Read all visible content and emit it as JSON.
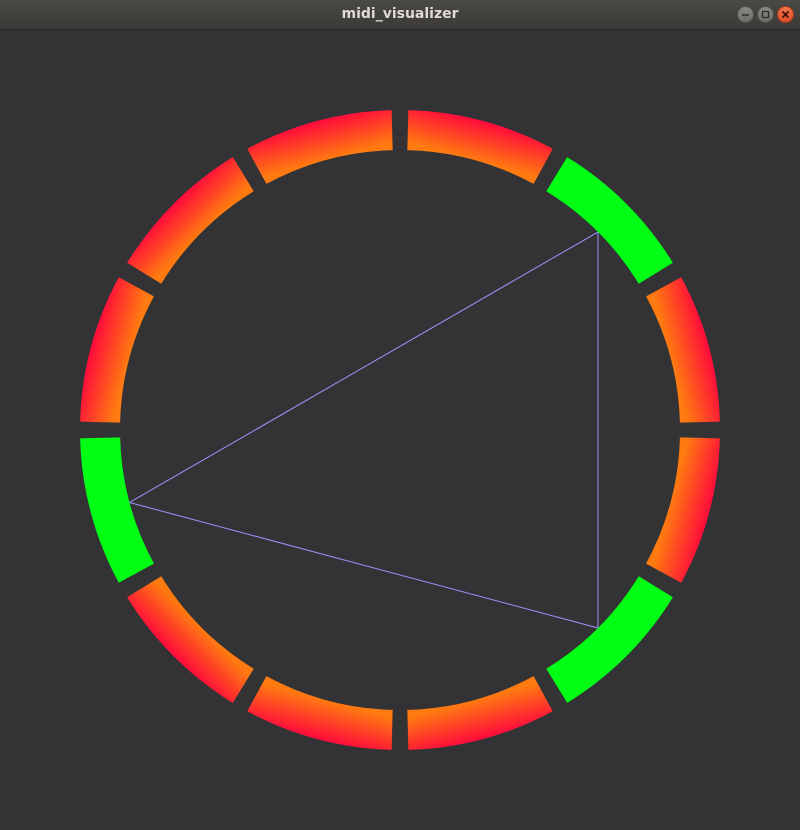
{
  "window": {
    "title": "midi_visualizer",
    "controls": [
      {
        "name": "minimize-button",
        "icon": "minimize-icon"
      },
      {
        "name": "maximize-button",
        "icon": "maximize-icon"
      },
      {
        "name": "close-button",
        "icon": "close-icon"
      }
    ]
  },
  "visualizer": {
    "segment_count": 12,
    "active_segments": [
      1,
      4,
      8
    ],
    "colors": {
      "background": "#333335",
      "active": "#00ff14",
      "inactive_gradient": [
        "#ff0a3c",
        "#ff7a10"
      ],
      "connector_line": "#9a95ff"
    }
  }
}
